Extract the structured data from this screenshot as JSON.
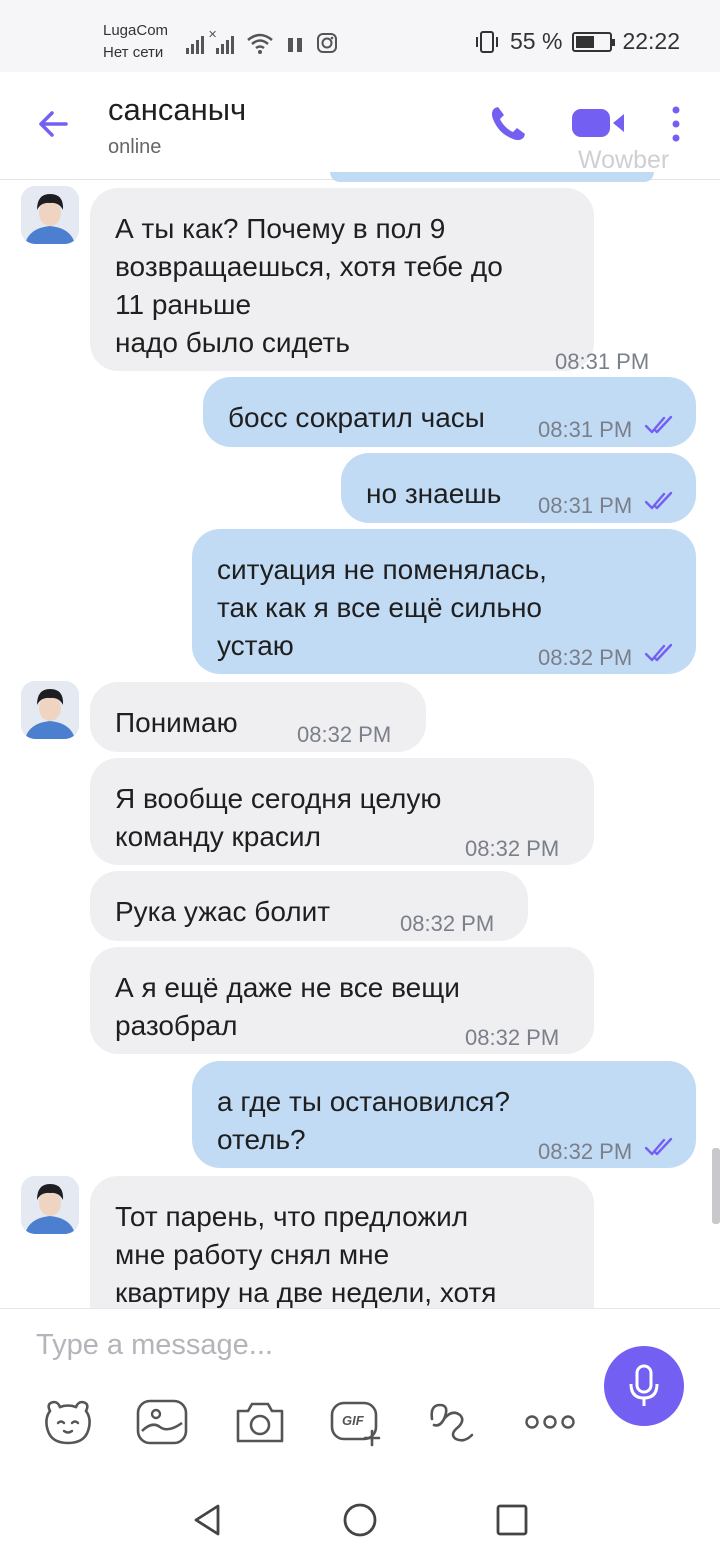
{
  "status_bar": {
    "carrier": "LugaCom",
    "network_status": "Нет сети",
    "battery_percent": "55 %",
    "battery_level": 0.55,
    "clock": "22:22"
  },
  "header": {
    "contact_name": "сансаныч",
    "contact_status": "online",
    "watermark": "Wowber"
  },
  "messages": [
    {
      "direction": "in",
      "avatar": true,
      "lines": [
        "А ты как? Почему в пол 9",
        "возвращаешься, хотя тебе до",
        "11 раньше",
        "надо было сидеть"
      ],
      "time": "08:31 PM"
    },
    {
      "direction": "out",
      "lines": [
        "босс сократил часы"
      ],
      "time": "08:31 PM",
      "read": true
    },
    {
      "direction": "out",
      "lines": [
        "но знаешь"
      ],
      "time": "08:31 PM",
      "read": true
    },
    {
      "direction": "out",
      "lines": [
        "ситуация не поменялась,",
        "так как я все ещё сильно",
        "устаю"
      ],
      "time": "08:32 PM",
      "read": true
    },
    {
      "direction": "in",
      "avatar": true,
      "lines": [
        "Понимаю"
      ],
      "time": "08:32 PM"
    },
    {
      "direction": "in",
      "lines": [
        "Я вообще сегодня целую",
        "команду красил"
      ],
      "time": "08:32 PM"
    },
    {
      "direction": "in",
      "lines": [
        "Рука ужас болит"
      ],
      "time": "08:32 PM"
    },
    {
      "direction": "in",
      "lines": [
        "А я ещё даже не все вещи",
        "разобрал"
      ],
      "time": "08:32 PM"
    },
    {
      "direction": "out",
      "lines": [
        "а где ты остановился?",
        "отель?"
      ],
      "time": "08:32 PM",
      "read": true
    },
    {
      "direction": "in",
      "avatar": true,
      "lines": [
        "Тот парень, что предложил",
        "мне работу снял мне",
        "квартиру на две недели, хотя"
      ],
      "time": ""
    }
  ],
  "composer": {
    "placeholder": "Type a message...",
    "gif_label": "GIF",
    "tools": [
      "sticker-icon",
      "gallery-icon",
      "camera-icon",
      "gif-icon",
      "doodle-icon",
      "more-options-icon"
    ]
  },
  "colors": {
    "accent": "#7360f2",
    "outgoing_bubble": "#c2dbf5",
    "incoming_bubble": "#efeff1"
  }
}
